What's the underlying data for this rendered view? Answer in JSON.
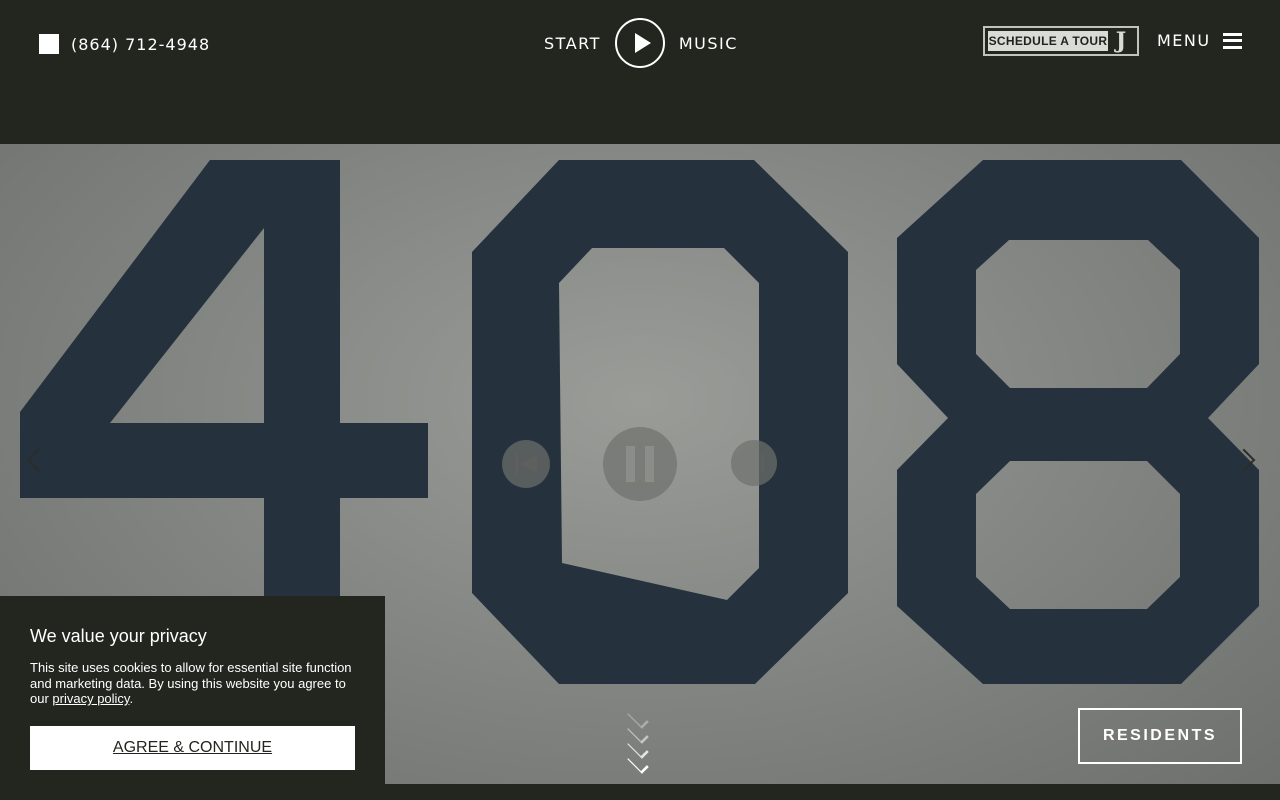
{
  "header": {
    "phone": "(864) 712-4948",
    "music_start": "START",
    "music_end": "MUSIC",
    "tour_label": "SCHEDULE A TOUR",
    "tour_logo": "J",
    "menu_label": "MENU"
  },
  "hero": {
    "number_text": "408",
    "number_color": "#25313d",
    "residents_label": "RESIDENTS"
  },
  "privacy": {
    "title": "We value your privacy",
    "body": "This site uses cookies to allow for essential site function and marketing data. By using this website you agree to our ",
    "link": "privacy policy",
    "body_end": ".",
    "button": "AGREE & CONTINUE"
  },
  "icons": [
    "play-icon",
    "hamburger-icon",
    "prev-track-icon",
    "pause-icon",
    "next-track-icon",
    "chevron-left-icon",
    "chevron-right-icon",
    "scroll-down-icon"
  ]
}
